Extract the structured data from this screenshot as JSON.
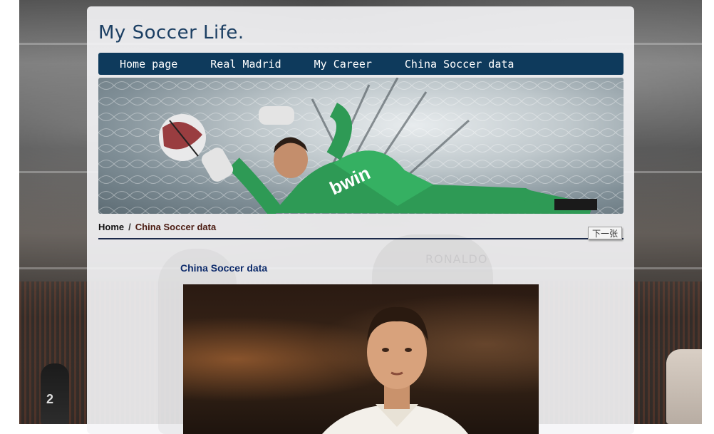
{
  "site": {
    "title": "My Soccer Life."
  },
  "nav": {
    "items": [
      {
        "label": "Home page"
      },
      {
        "label": "Real Madrid"
      },
      {
        "label": "My Career"
      },
      {
        "label": "China Soccer data"
      }
    ]
  },
  "breadcrumb": {
    "home": "Home",
    "separator": "/",
    "current": "China Soccer data"
  },
  "next_button": {
    "label": "下一张"
  },
  "content": {
    "heading": "China Soccer data"
  },
  "colors": {
    "nav_bg": "#0e3a5c",
    "title": "#1c3f63",
    "heading": "#0d2b6b",
    "keeper_kit": "#2e9a55"
  },
  "icons": {
    "banner": "goalkeeper-dive-image",
    "photo": "player-portrait-image"
  }
}
